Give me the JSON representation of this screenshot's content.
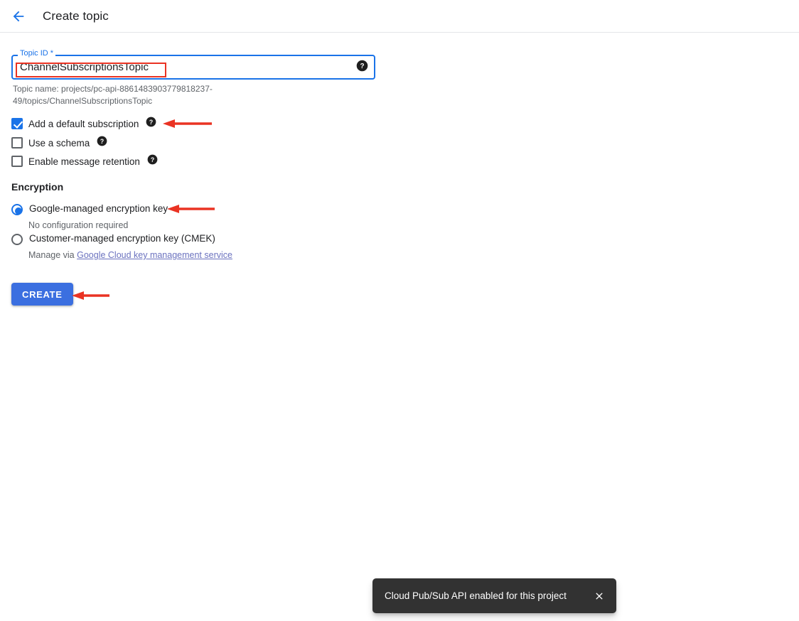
{
  "header": {
    "back_icon": "arrow-left-icon",
    "title": "Create topic"
  },
  "form": {
    "topic_id": {
      "label": "Topic ID *",
      "value": "ChannelSubscriptionsTopic",
      "placeholder": "",
      "help_icon": "help-circle-icon"
    },
    "helper_text": "Topic name: projects/pc-api-8861483903779818237-49/topics/ChannelSubscriptionsTopic",
    "checkboxes": [
      {
        "label": "Add a default subscription",
        "checked": "true",
        "help_icon": "help-circle-icon"
      },
      {
        "label": "Use a schema",
        "checked": "false",
        "help_icon": "help-circle-icon"
      },
      {
        "label": "Enable message retention",
        "checked": "false",
        "help_icon": "help-circle-icon"
      }
    ],
    "encryption": {
      "section_title": "Encryption",
      "options": [
        {
          "label": "Google-managed encryption key",
          "sub": "No configuration required",
          "selected": "true"
        },
        {
          "label": "Customer-managed encryption key (CMEK)",
          "sub_prefix": "Manage via ",
          "sub_link": "Google Cloud key management service",
          "selected": "false"
        }
      ]
    },
    "create_button": "CREATE"
  },
  "toast": {
    "message": "Cloud Pub/Sub API enabled for this project",
    "close_icon": "close-icon"
  },
  "annotations": {
    "arrow_color": "#ea3323",
    "highlight_box_color": "#ea3323",
    "arrow_labels": [
      "arrow-pointing-to-add-default-subscription",
      "arrow-pointing-to-google-managed-encryption-key",
      "arrow-pointing-to-create-button"
    ]
  },
  "colors": {
    "accent_blue": "#1a73e8",
    "button_blue": "#3b6fe0",
    "text_primary": "#202124",
    "text_secondary": "#5f6368",
    "toast_bg": "#323232",
    "annotation_red": "#ea3323"
  }
}
